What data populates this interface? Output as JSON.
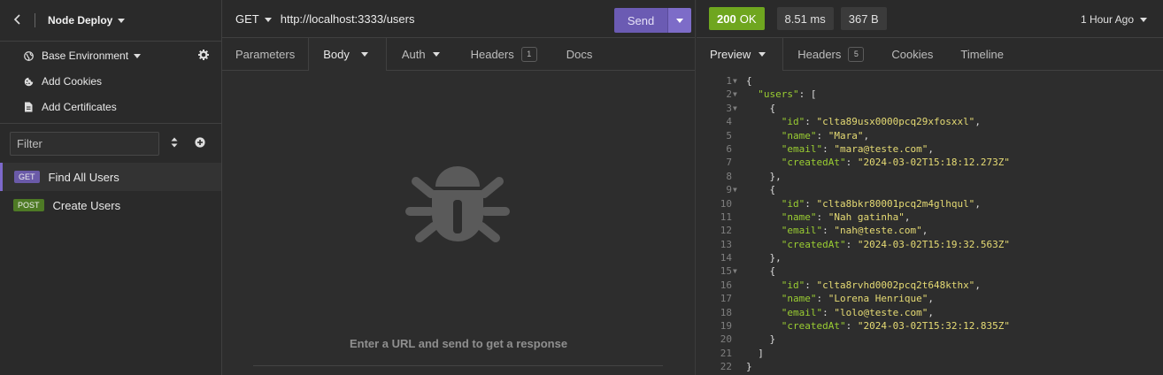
{
  "sidebar": {
    "back_icon": "chevron-left-icon",
    "workspace": "Node Deploy",
    "environment": "Base Environment",
    "add_cookies": "Add Cookies",
    "add_certificates": "Add Certificates",
    "filter_placeholder": "Filter",
    "requests": [
      {
        "method": "GET",
        "name": "Find All Users",
        "badge_color": "#6a5aa8",
        "active": true
      },
      {
        "method": "POST",
        "name": "Create Users",
        "badge_color": "#4e7a25",
        "active": false
      }
    ]
  },
  "request": {
    "method": "GET",
    "url": "http://localhost:3333/users",
    "send_label": "Send",
    "tabs": [
      {
        "label": "Parameters"
      },
      {
        "label": "Body"
      },
      {
        "label": "Auth"
      },
      {
        "label": "Headers",
        "count": "1"
      },
      {
        "label": "Docs"
      }
    ],
    "empty_message": "Enter a URL and send to get a response"
  },
  "response": {
    "status_code": "200",
    "status_text": "OK",
    "time": "8.51 ms",
    "size": "367 B",
    "history": "1 Hour Ago",
    "tabs": [
      {
        "label": "Preview"
      },
      {
        "label": "Headers",
        "count": "5"
      },
      {
        "label": "Cookies"
      },
      {
        "label": "Timeline"
      }
    ],
    "body_lines": [
      "{",
      "  \"users\": [",
      "    {",
      "      \"id\": \"clta89usx0000pcq29xfosxxl\",",
      "      \"name\": \"Mara\",",
      "      \"email\": \"mara@teste.com\",",
      "      \"createdAt\": \"2024-03-02T15:18:12.273Z\"",
      "    },",
      "    {",
      "      \"id\": \"clta8bkr80001pcq2m4glhqul\",",
      "      \"name\": \"Nah gatinha\",",
      "      \"email\": \"nah@teste.com\",",
      "      \"createdAt\": \"2024-03-02T15:19:32.563Z\"",
      "    },",
      "    {",
      "      \"id\": \"clta8rvhd0002pcq2t648kthx\",",
      "      \"name\": \"Lorena Henrique\",",
      "      \"email\": \"lolo@teste.com\",",
      "      \"createdAt\": \"2024-03-02T15:32:12.835Z\"",
      "    }",
      "  ]",
      "}"
    ],
    "foldable_lines": [
      1,
      2,
      3,
      9,
      15
    ]
  },
  "colors": {
    "accent": "#7d69cb",
    "status_ok": "#6fa61f",
    "json_key": "#9acd32",
    "json_string": "#e6db74"
  }
}
